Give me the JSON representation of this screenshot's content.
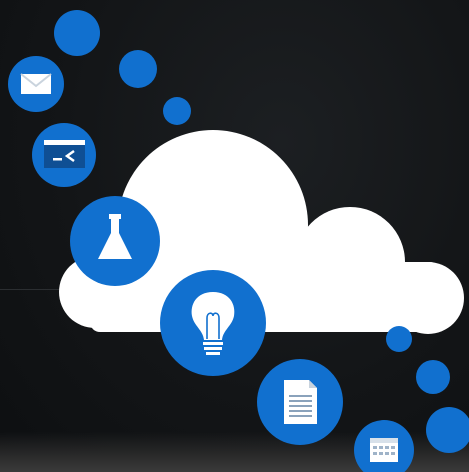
{
  "scene": {
    "description_icons": [
      "mail-icon",
      "terminal-icon",
      "flask-icon",
      "lightbulb-icon",
      "document-icon",
      "calendar-icon"
    ],
    "colors": {
      "background": "#121417",
      "cloud": "#ffffff",
      "circle_blue": "#1170cf",
      "icon_white": "#ffffff"
    }
  }
}
